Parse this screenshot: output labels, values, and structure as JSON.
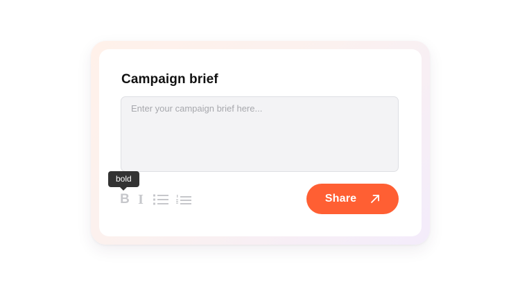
{
  "card": {
    "title": "Campaign brief"
  },
  "brief_input": {
    "placeholder": "Enter your campaign brief here...",
    "value": ""
  },
  "toolbar": {
    "tooltip": "bold",
    "bold_glyph": "B",
    "italic_glyph": "I",
    "icons": [
      "bold-icon",
      "italic-icon",
      "bulleted-list-icon",
      "numbered-list-icon"
    ]
  },
  "share_button": {
    "label": "Share",
    "icon": "arrow-up-right-icon"
  },
  "colors": {
    "accent": "#ff5f33",
    "tooltip_bg": "#333333",
    "toolbar_icon": "#c6c7cb",
    "input_bg": "#f3f3f5"
  }
}
